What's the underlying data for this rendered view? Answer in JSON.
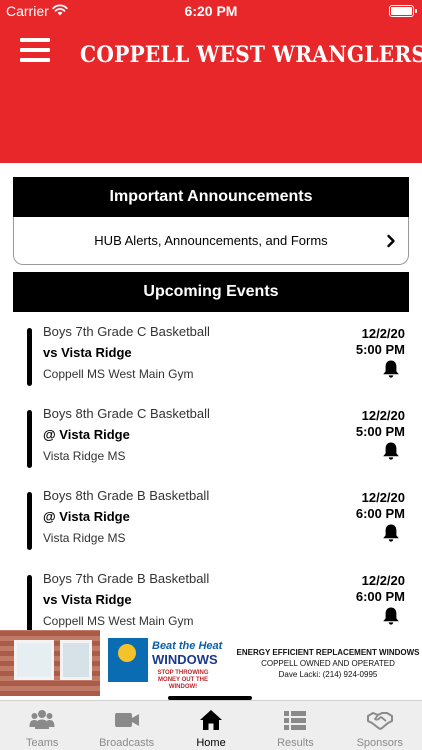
{
  "status_bar": {
    "carrier": "Carrier",
    "time": "6:20 PM"
  },
  "header": {
    "title": "COPPELL WEST WRANGLERS",
    "menu_icon": "hamburger-menu-icon",
    "background_color": "#e8272a"
  },
  "announcements": {
    "title": "Important Announcements",
    "link_label": "HUB Alerts, Announcements, and Forms",
    "link_icon": "chevron-right-icon"
  },
  "events": {
    "title": "Upcoming Events",
    "items": [
      {
        "team": "Boys 7th Grade C Basketball",
        "opponent": "vs Vista Ridge",
        "location": "Coppell MS West Main Gym",
        "date": "12/2/20",
        "time": "5:00 PM",
        "icon": "bell-icon"
      },
      {
        "team": "Boys 8th Grade C Basketball",
        "opponent": "@ Vista Ridge",
        "location": "Vista Ridge MS",
        "date": "12/2/20",
        "time": "5:00 PM",
        "icon": "bell-icon"
      },
      {
        "team": "Boys 8th Grade B Basketball",
        "opponent": "@ Vista Ridge",
        "location": "Vista Ridge MS",
        "date": "12/2/20",
        "time": "6:00 PM",
        "icon": "bell-icon"
      },
      {
        "team": "Boys 7th Grade B Basketball",
        "opponent": "vs Vista Ridge",
        "location": "Coppell MS West Main Gym",
        "date": "12/2/20",
        "time": "6:00 PM",
        "icon": "bell-icon"
      }
    ]
  },
  "ad": {
    "brand_line1": "Beat the Heat",
    "brand_line2": "WINDOWS",
    "tagline": "STOP THROWING MONEY OUT THE WINDOW!",
    "headline": "ENERGY EFFICIENT REPLACEMENT WINDOWS",
    "subline": "COPPELL OWNED AND OPERATED",
    "contact": "Dave Lacki: (214) 924-0995"
  },
  "tabs": [
    {
      "label": "Teams",
      "icon": "teams-icon",
      "active": false
    },
    {
      "label": "Broadcasts",
      "icon": "video-camera-icon",
      "active": false
    },
    {
      "label": "Home",
      "icon": "home-icon",
      "active": true
    },
    {
      "label": "Results",
      "icon": "results-list-icon",
      "active": false
    },
    {
      "label": "Sponsors",
      "icon": "handshake-icon",
      "active": false
    }
  ]
}
